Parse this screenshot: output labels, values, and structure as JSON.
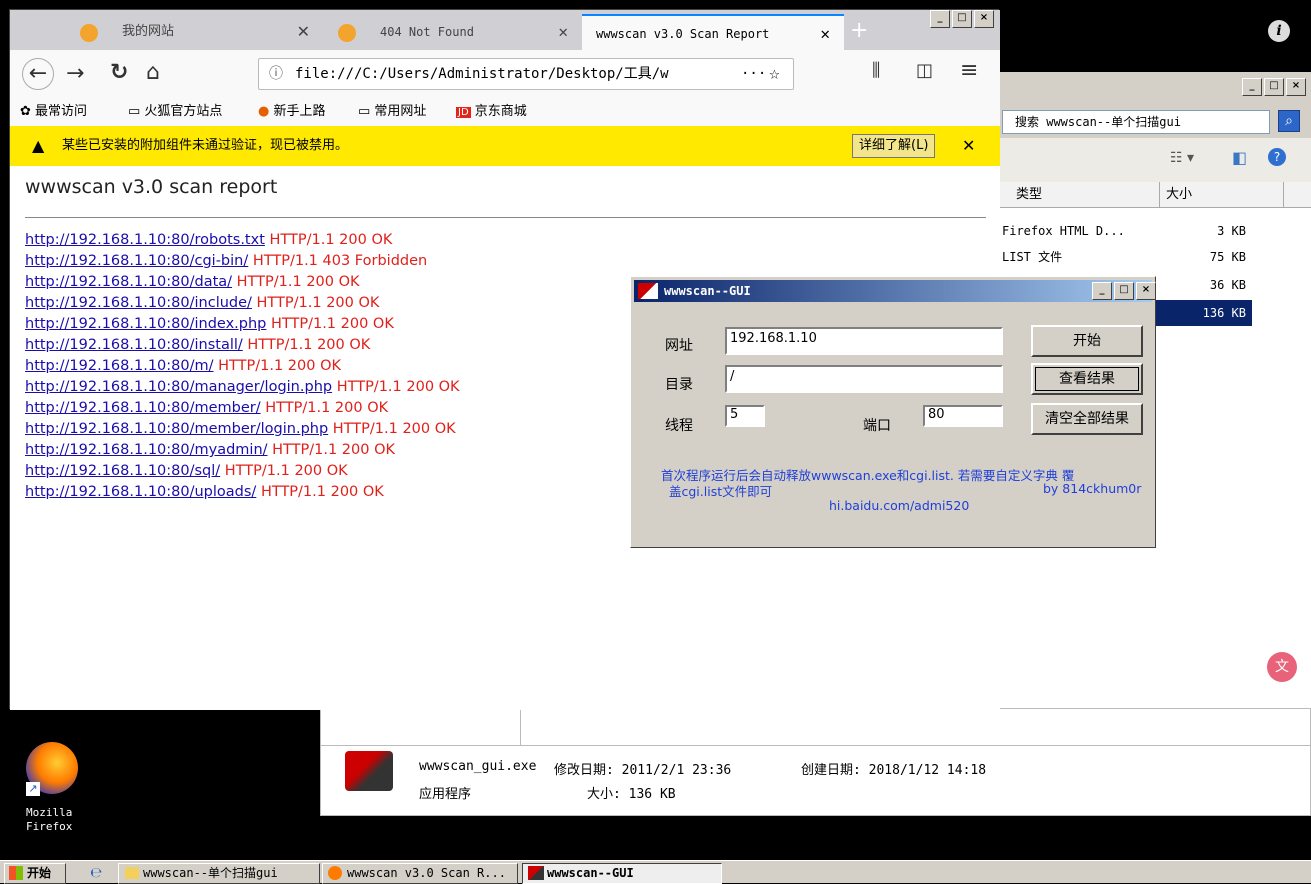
{
  "explorer": {
    "search_text": "搜索 wwwscan--单个扫描gui",
    "columns": [
      "类型",
      "大小"
    ],
    "rows": [
      {
        "type": "Firefox HTML D...",
        "size": "3 KB"
      },
      {
        "type": "LIST 文件",
        "size": "75 KB"
      },
      {
        "type": "",
        "size": "36 KB"
      },
      {
        "type": "",
        "size": "136 KB"
      }
    ],
    "details": {
      "filename": "wwwscan_gui.exe",
      "modified": "修改日期: 2011/2/1 23:36",
      "created": "创建日期: 2018/1/12 14:18",
      "kind": "应用程序",
      "size": "大小: 136 KB"
    }
  },
  "firefox": {
    "tabs": [
      {
        "label": "我的网站"
      },
      {
        "label": "404 Not Found"
      },
      {
        "label": "wwwscan v3.0 Scan Report"
      }
    ],
    "url": "file:///C:/Users/Administrator/Desktop/工具/w",
    "bookmarks": [
      "最常访问",
      "火狐官方站点",
      "新手上路",
      "常用网址",
      "京东商城"
    ],
    "notice": "某些已安装的附加组件未通过验证，现已被禁用。",
    "notice_button": "详细了解(L)",
    "report_title": "wwwscan v3.0 scan report",
    "results": [
      {
        "url": "http://192.168.1.10:80/robots.txt",
        "status": "HTTP/1.1 200 OK"
      },
      {
        "url": "http://192.168.1.10:80/cgi-bin/",
        "status": "HTTP/1.1 403 Forbidden"
      },
      {
        "url": "http://192.168.1.10:80/data/",
        "status": "HTTP/1.1 200 OK"
      },
      {
        "url": "http://192.168.1.10:80/include/",
        "status": "HTTP/1.1 200 OK"
      },
      {
        "url": "http://192.168.1.10:80/index.php",
        "status": "HTTP/1.1 200 OK"
      },
      {
        "url": "http://192.168.1.10:80/install/",
        "status": "HTTP/1.1 200 OK"
      },
      {
        "url": "http://192.168.1.10:80/m/",
        "status": "HTTP/1.1 200 OK"
      },
      {
        "url": "http://192.168.1.10:80/manager/login.php",
        "status": "HTTP/1.1 200 OK"
      },
      {
        "url": "http://192.168.1.10:80/member/",
        "status": "HTTP/1.1 200 OK"
      },
      {
        "url": "http://192.168.1.10:80/member/login.php",
        "status": "HTTP/1.1 200 OK"
      },
      {
        "url": "http://192.168.1.10:80/myadmin/",
        "status": "HTTP/1.1 200 OK"
      },
      {
        "url": "http://192.168.1.10:80/sql/",
        "status": "HTTP/1.1 200 OK"
      },
      {
        "url": "http://192.168.1.10:80/uploads/",
        "status": "HTTP/1.1 200 OK"
      }
    ]
  },
  "gui": {
    "title": "wwwscan--GUI",
    "url_label": "网址",
    "url_value": "192.168.1.10",
    "dir_label": "目录",
    "dir_value": "/",
    "threads_label": "线程",
    "threads_value": "5",
    "port_label": "端口",
    "port_value": "80",
    "start_btn": "开始",
    "view_btn": "查看结果",
    "clear_btn": "清空全部结果",
    "note1": "首次程序运行后会自动释放wwwscan.exe和cgi.list.  若需要自定义字典 覆",
    "note2": "盖cgi.list文件即可",
    "note3": "by 814ckhum0r",
    "note4": "hi.baidu.com/admi520"
  },
  "desktop": {
    "icon_label_1": "Mozilla",
    "icon_label_2": "Firefox"
  },
  "taskbar": {
    "start": "开始",
    "tasks": [
      "wwwscan--单个扫描gui",
      "wwwscan v3.0 Scan R...",
      "wwwscan--GUI"
    ]
  }
}
